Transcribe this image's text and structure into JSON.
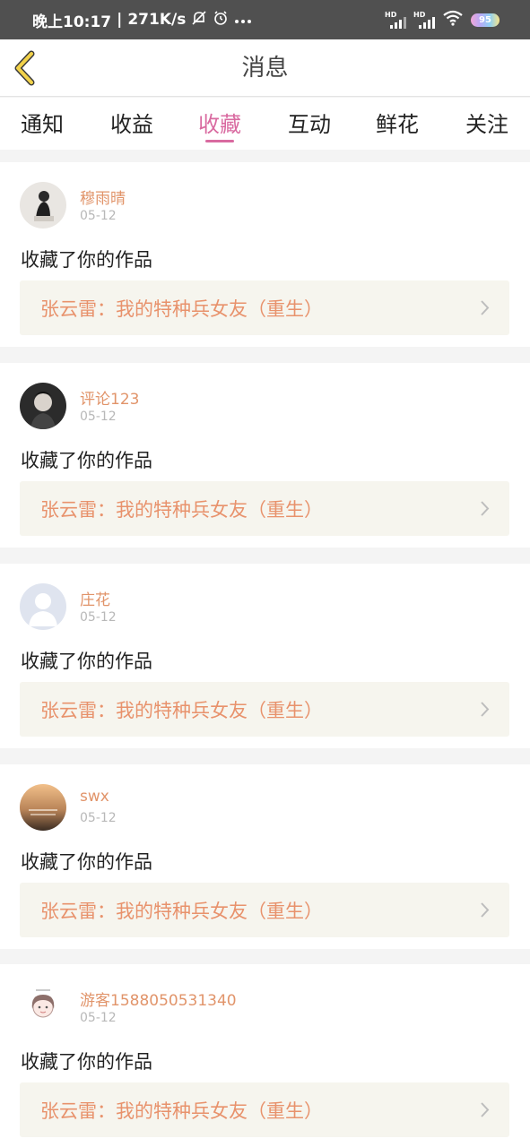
{
  "status_bar": {
    "time": "晚上10:17",
    "speed": "271K/s",
    "signal_label_1": "HD",
    "signal_label_2": "HD",
    "battery": "95"
  },
  "nav": {
    "title": "消息"
  },
  "tabs": [
    {
      "label": "通知"
    },
    {
      "label": "收益"
    },
    {
      "label": "收藏"
    },
    {
      "label": "互动"
    },
    {
      "label": "鲜花"
    },
    {
      "label": "关注"
    }
  ],
  "active_tab": "收藏",
  "colors": {
    "accent": "#d96aa0",
    "username": "#e1946a",
    "work_title": "#e8926c",
    "card_link_bg": "#f6f5ee",
    "status_bar": "#505050"
  },
  "items": [
    {
      "username": "穆雨晴",
      "date": "05-12",
      "action": "收藏了你的作品",
      "work_title": "张云雷：我的特种兵女友（重生）",
      "avatar": "user-photo-avatar"
    },
    {
      "username": "评论123",
      "date": "05-12",
      "action": "收藏了你的作品",
      "work_title": "张云雷：我的特种兵女友（重生）",
      "avatar": "user-photo-avatar"
    },
    {
      "username": "庄花",
      "date": "05-12",
      "action": "收藏了你的作品",
      "work_title": "张云雷：我的特种兵女友（重生）",
      "avatar": "default-avatar"
    },
    {
      "username": "swx",
      "date": "05-12",
      "action": "收藏了你的作品",
      "work_title": "张云雷：我的特种兵女友（重生）",
      "avatar": "sunset-photo-avatar"
    },
    {
      "username": "游客1588050531340",
      "date": "05-12",
      "action": "收藏了你的作品",
      "work_title": "张云雷：我的特种兵女友（重生）",
      "avatar": "cartoon-girl-avatar"
    }
  ]
}
